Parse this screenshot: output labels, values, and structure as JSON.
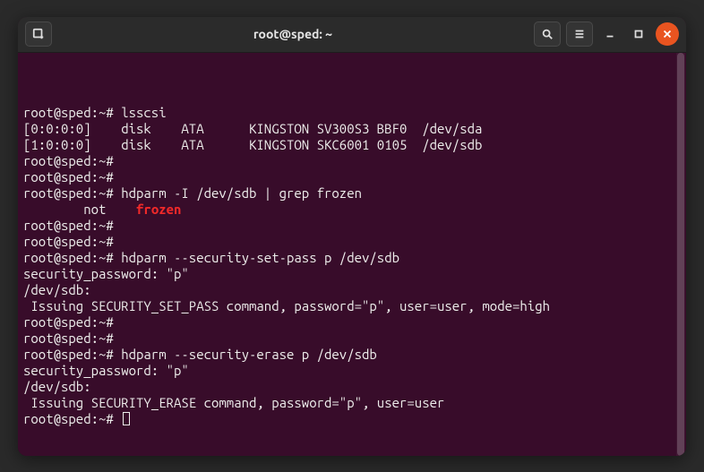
{
  "window": {
    "title": "root@sped: ~"
  },
  "prompt": "root@sped:~# ",
  "lines": [
    {
      "type": "cmd",
      "text": "lsscsi"
    },
    {
      "type": "out",
      "text": "[0:0:0:0]    disk    ATA      KINGSTON SV300S3 BBF0  /dev/sda"
    },
    {
      "type": "out",
      "text": "[1:0:0:0]    disk    ATA      KINGSTON SKC6001 0105  /dev/sdb"
    },
    {
      "type": "cmd",
      "text": ""
    },
    {
      "type": "cmd",
      "text": ""
    },
    {
      "type": "cmd",
      "text": "hdparm -I /dev/sdb | grep frozen"
    },
    {
      "type": "out-hl",
      "pre": "        not    ",
      "hl": "frozen"
    },
    {
      "type": "cmd",
      "text": ""
    },
    {
      "type": "cmd",
      "text": ""
    },
    {
      "type": "cmd",
      "text": "hdparm --security-set-pass p /dev/sdb"
    },
    {
      "type": "out",
      "text": "security_password: \"p\""
    },
    {
      "type": "out",
      "text": ""
    },
    {
      "type": "out",
      "text": "/dev/sdb:"
    },
    {
      "type": "out",
      "text": " Issuing SECURITY_SET_PASS command, password=\"p\", user=user, mode=high"
    },
    {
      "type": "cmd",
      "text": ""
    },
    {
      "type": "cmd",
      "text": ""
    },
    {
      "type": "cmd",
      "text": "hdparm --security-erase p /dev/sdb"
    },
    {
      "type": "out",
      "text": "security_password: \"p\""
    },
    {
      "type": "out",
      "text": ""
    },
    {
      "type": "out",
      "text": "/dev/sdb:"
    },
    {
      "type": "out",
      "text": " Issuing SECURITY_ERASE command, password=\"p\", user=user"
    },
    {
      "type": "cmd-cursor",
      "text": ""
    }
  ]
}
